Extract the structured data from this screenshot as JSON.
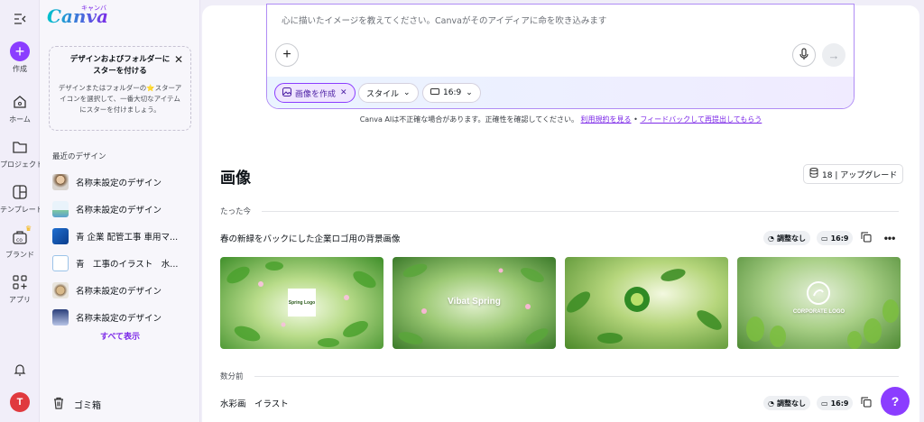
{
  "rail": {
    "create_label": "作成",
    "home_label": "ホーム",
    "projects_label": "プロジェクト",
    "templates_label": "テンプレート",
    "brand_label": "ブランド",
    "apps_label": "アプリ",
    "avatar_initial": "T"
  },
  "panel": {
    "logo_text": "Canva",
    "logo_kana": "キャンバ",
    "star_card": {
      "title_line1": "デザインおよびフォルダーに",
      "title_line2": "スターを付ける",
      "body_line1": "デザインまたはフォルダーの",
      "body_star": "⭐",
      "body_line1b": "スターア",
      "body_line2": "イコンを選択して、一番大切なアイテム",
      "body_line3": "にスターを付けましょう。"
    },
    "recent_title": "最近のデザイン",
    "recent_items": [
      {
        "label": "名称未設定のデザイン"
      },
      {
        "label": "名称未設定のデザイン"
      },
      {
        "label": "青 企業 配管工事 車用マ..."
      },
      {
        "label": "青　工事のイラスト　水..."
      },
      {
        "label": "名称未設定のデザイン"
      },
      {
        "label": "名称未設定のデザイン"
      }
    ],
    "show_all": "すべて表示",
    "trash_label": "ゴミ箱"
  },
  "prompt": {
    "placeholder": "心に描いたイメージを教えてください。Canvaがそのアイディアに命を吹き込みます",
    "chip_create": "画像を作成",
    "chip_style": "スタイル",
    "chip_ratio": "16:9"
  },
  "disclaimer": {
    "text": "Canva AIは不正確な場合があります。正確性を確認してください。",
    "terms_link": "利用規約を見る",
    "separator": " • ",
    "feedback_link": "フィードバックして再提出してもらう"
  },
  "images_section": {
    "title": "画像",
    "upgrade_label": "18 | アップグレード",
    "groups": [
      {
        "time_label": "たった今",
        "row_title": "春の新緑をバックにした企業ロゴ用の背景画像",
        "adjust_label": "調整なし",
        "ratio_label": "16:9",
        "tiles": [
          {
            "caption": "Spring Logo"
          },
          {
            "caption": "Vibat Spring"
          },
          {
            "caption": ""
          },
          {
            "caption": "CORPORATE LOGO"
          }
        ]
      },
      {
        "time_label": "数分前",
        "row_title": "水彩画　イラスト",
        "adjust_label": "調整なし",
        "ratio_label": "16:9"
      }
    ]
  },
  "help_label": "?"
}
